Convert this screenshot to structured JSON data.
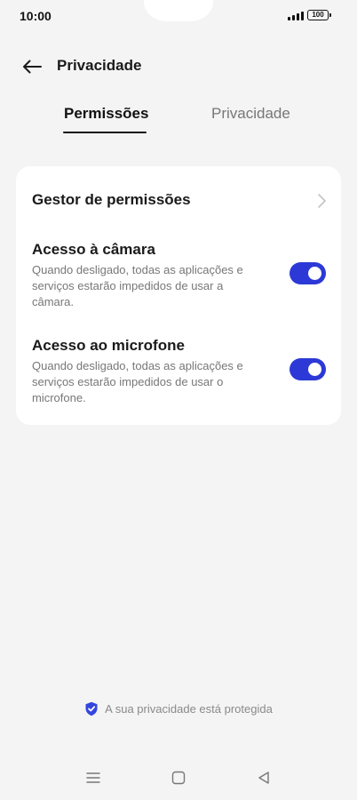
{
  "status_bar": {
    "time": "10:00",
    "battery": "100",
    "icons": [
      "signal-icon",
      "battery-icon"
    ]
  },
  "header": {
    "back_icon": "arrow-left-icon",
    "title": "Privacidade"
  },
  "tabs": [
    {
      "label": "Permissões",
      "selected": true
    },
    {
      "label": "Privacidade",
      "selected": false
    }
  ],
  "card": {
    "permission_manager": {
      "label": "Gestor de permissões",
      "icon": "chevron-right-icon"
    },
    "camera_access": {
      "label": "Acesso à câmara",
      "description": "Quando desligado, todas as aplicações e serviços estarão impedidos de usar a câmara.",
      "enabled": true
    },
    "microphone_access": {
      "label": "Acesso ao microfone",
      "description": "Quando desligado, todas as aplicações e serviços estarão impedidos de usar o microfone.",
      "enabled": true
    }
  },
  "footer": {
    "icon": "shield-check-icon",
    "text": "A sua privacidade está protegida"
  },
  "nav_bar": {
    "icons": [
      "menu-icon",
      "home-icon",
      "back-triangle-icon"
    ]
  },
  "colors": {
    "accent": "#2c39d6",
    "background": "#f4f4f4",
    "card": "#ffffff"
  }
}
